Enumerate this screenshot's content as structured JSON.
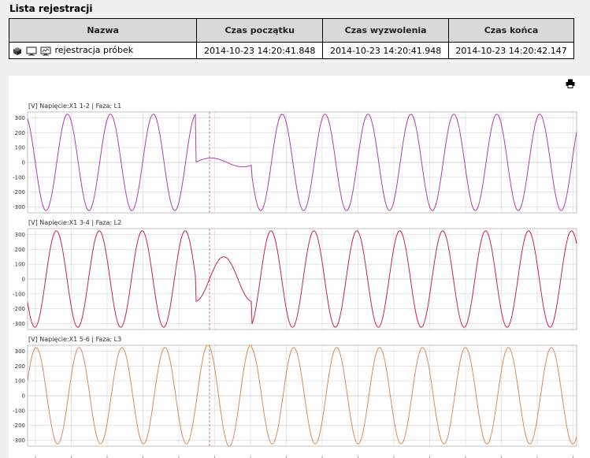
{
  "header": {
    "title": "Lista rejestracji"
  },
  "table": {
    "columns": [
      "Nazwa",
      "Czas początku",
      "Czas wyzwolenia",
      "Czas końca"
    ],
    "rows": [
      {
        "name": "rejestracja próbek",
        "start": "2014-10-23 14:20:41.848",
        "trigger": "2014-10-23 14:20:41.948",
        "end": "2014-10-23 14:20:42.147"
      }
    ]
  },
  "toolbar": {
    "print_icon": "printer-icon"
  },
  "colors": {
    "l1": "#b03cb0",
    "l2": "#cc1f5a",
    "l3": "#de8a55",
    "trigger": "#e05050"
  },
  "chart_data": [
    {
      "type": "line",
      "title": "[V] Napięcie:X1 1-2 | Faza: L1",
      "ytick_labels": [
        "300",
        "200",
        "100",
        "0",
        "-100",
        "-200",
        "-300"
      ],
      "x_unit": "ms",
      "x_range": [
        -100,
        200
      ]
    },
    {
      "type": "line",
      "title": "[V] Napięcie:X1 3-4 | Faza: L2",
      "ytick_labels": [
        "300",
        "200",
        "100",
        "0",
        "-100",
        "-200",
        "-300"
      ],
      "x_unit": "ms",
      "x_range": [
        -100,
        200
      ]
    },
    {
      "type": "line",
      "title": "[V] Napięcie:X1 5-6 | Faza: L3",
      "ytick_labels": [
        "300",
        "200",
        "100",
        "0",
        "-100",
        "-200",
        "-300"
      ],
      "x_unit": "ms",
      "x_range": [
        -100,
        200
      ]
    }
  ]
}
